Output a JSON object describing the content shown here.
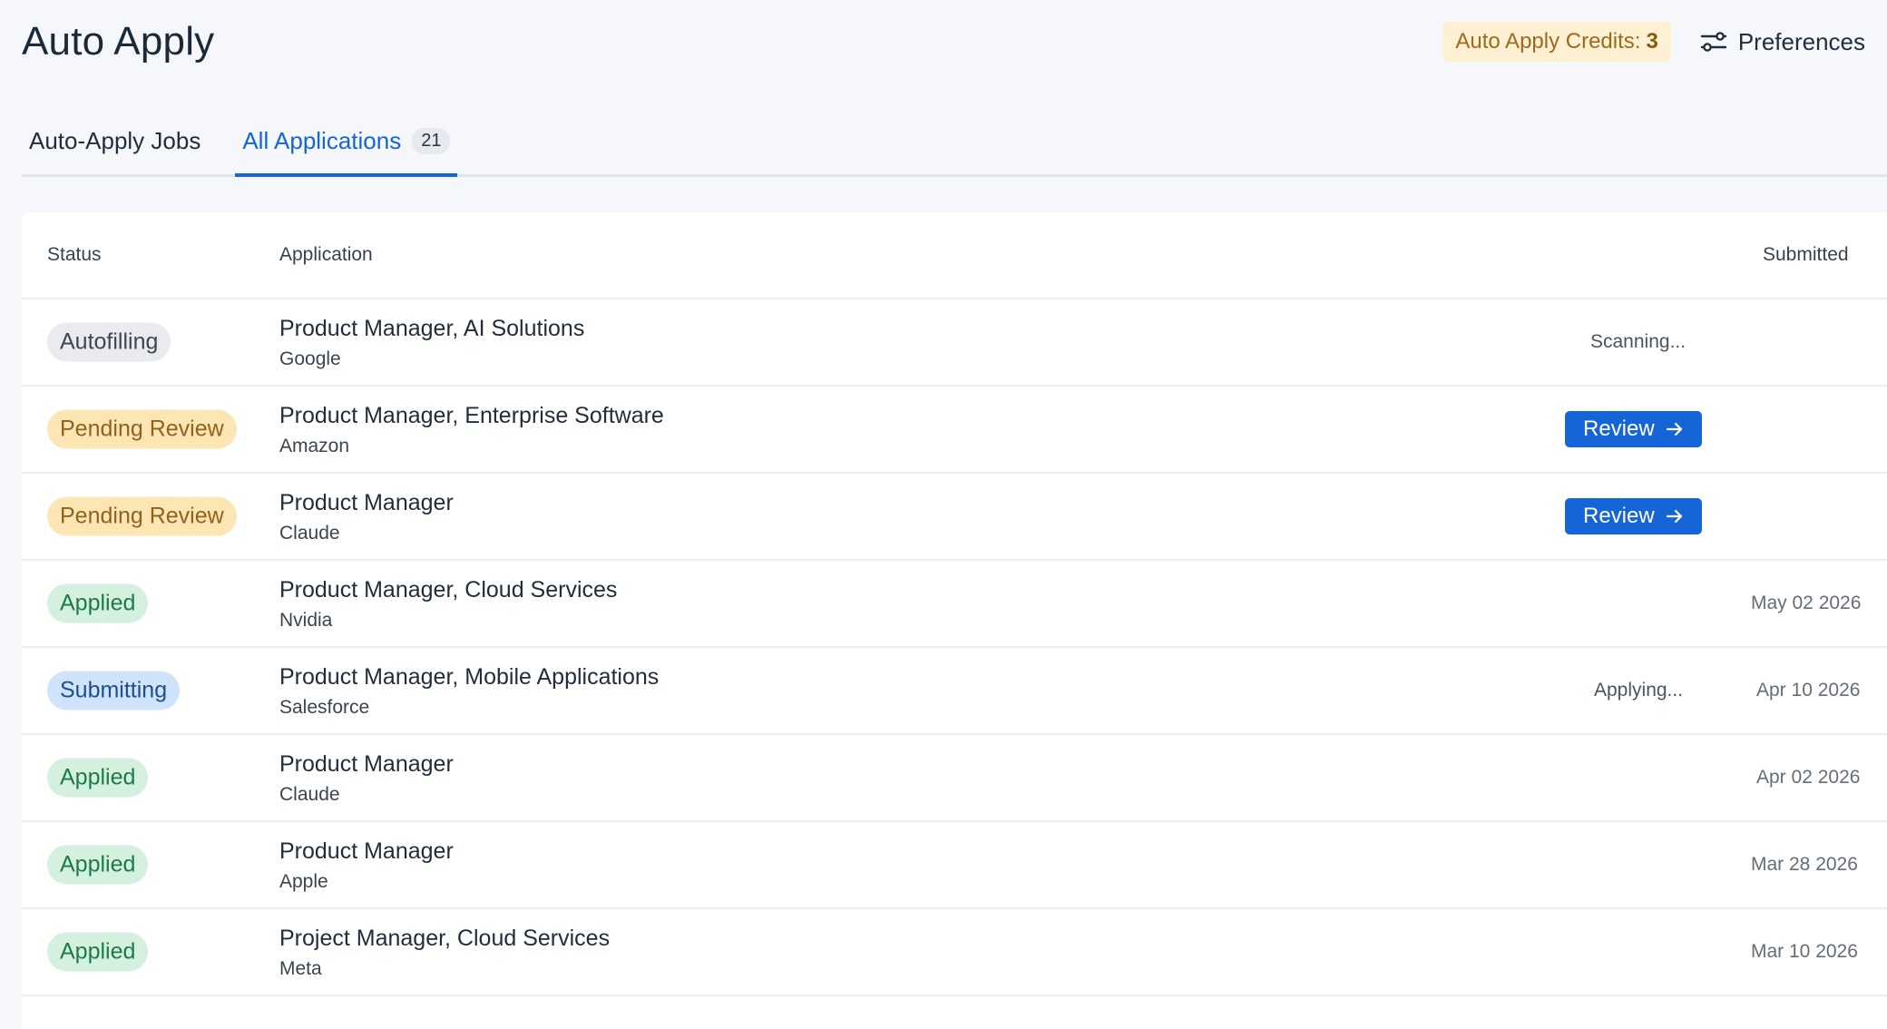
{
  "header": {
    "title": "Auto Apply",
    "credits_label": "Auto Apply Credits:",
    "credits_value": "3",
    "preferences_label": "Preferences"
  },
  "tabs": [
    {
      "label": "Auto-Apply Jobs",
      "count": "",
      "active": false
    },
    {
      "label": "All Applications",
      "count": "21",
      "active": true
    }
  ],
  "table": {
    "columns": {
      "status": "Status",
      "application": "Application",
      "submitted": "Submitted"
    },
    "rows": [
      {
        "status": "Autofilling",
        "title": "Product Manager, AI Solutions",
        "company": "Google",
        "action": "Scanning...",
        "submitted": ""
      },
      {
        "status": "Pending Review",
        "title": "Product Manager, Enterprise Software",
        "company": "Amazon",
        "action": "Review",
        "submitted": ""
      },
      {
        "status": "Pending Review",
        "title": "Product Manager",
        "company": "Claude",
        "action": "Review",
        "submitted": ""
      },
      {
        "status": "Applied",
        "title": "Product Manager, Cloud Services",
        "company": "Nvidia",
        "action": "",
        "submitted": "May 02 2026"
      },
      {
        "status": "Submitting",
        "title": "Product Manager, Mobile Applications",
        "company": "Salesforce",
        "action": "Applying...",
        "submitted": "Apr 10 2026"
      },
      {
        "status": "Applied",
        "title": "Product Manager",
        "company": "Claude",
        "action": "",
        "submitted": "Apr 02 2026"
      },
      {
        "status": "Applied",
        "title": "Product Manager",
        "company": "Apple",
        "action": "",
        "submitted": "Mar 28 2026"
      },
      {
        "status": "Applied",
        "title": "Project Manager, Cloud Services",
        "company": "Meta",
        "action": "",
        "submitted": "Mar 10 2026"
      }
    ]
  },
  "colors": {
    "accent": "#1565d8",
    "background": "#f5f7fa",
    "pending": "#fde6b3",
    "applied": "#d3f1de",
    "submitting": "#cfe3fb",
    "autofilling": "#e9ebee"
  },
  "icons": {
    "preferences": "sliders-icon",
    "review": "arrow-right-icon"
  }
}
